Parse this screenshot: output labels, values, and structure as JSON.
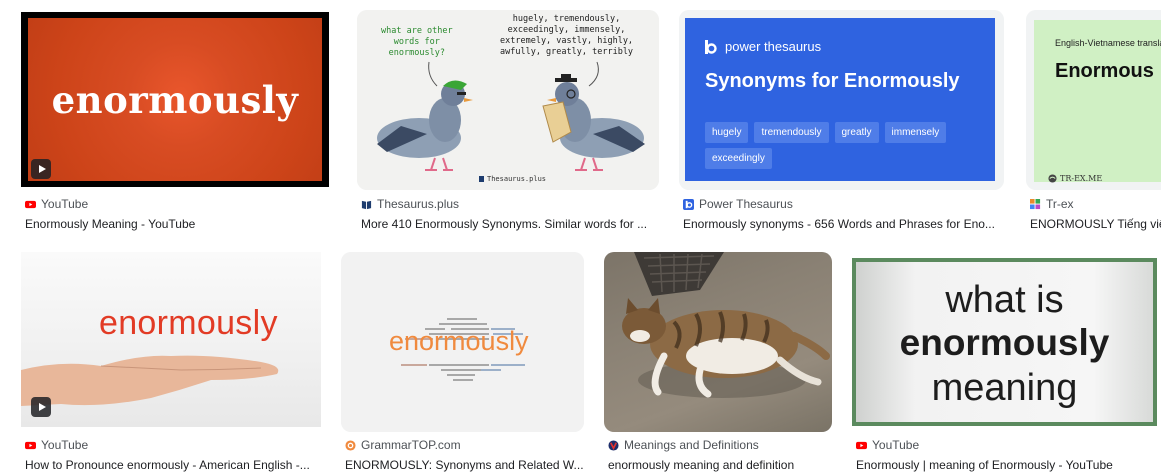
{
  "results": [
    {
      "source": "YouTube",
      "title": "Enormously Meaning - YouTube",
      "image_text": "enormously",
      "favicon": "youtube-icon",
      "has_video": true
    },
    {
      "source": "Thesaurus.plus",
      "title": "More 410 Enormously Synonyms. Similar words for ...",
      "favicon": "book-icon",
      "bubble_left": "what are other\nwords for\nenormously?",
      "bubble_right": "hugely, tremendously,\nexceedingly, immensely,\nextremely, vastly, highly,\nawfully, greatly, terribly",
      "watermark": "Thesaurus.plus"
    },
    {
      "source": "Power Thesaurus",
      "title": "Enormously synonyms - 656 Words and Phrases for Eno...",
      "favicon": "power-thesaurus-icon",
      "brand": "power thesaurus",
      "heading": "Synonyms for Enormously",
      "tags": [
        "hugely",
        "tremendously",
        "greatly",
        "immensely",
        "exceedingly"
      ]
    },
    {
      "source": "Tr-ex",
      "title": "ENORMOUSLY Tiếng việ",
      "favicon": "tr-ex-icon",
      "caption": "English-Vietnamese translat",
      "word": "Enormous",
      "logo": "TR-EX.ME"
    },
    {
      "source": "YouTube",
      "title": "How to Pronounce enormously - American English -...",
      "image_text": "enormously",
      "favicon": "youtube-icon",
      "has_video": true
    },
    {
      "source": "GrammarTOP.com",
      "title": "ENORMOUSLY: Synonyms and Related W...",
      "favicon": "grammartop-icon",
      "image_text": "enormously"
    },
    {
      "source": "Meanings and Definitions",
      "title": "enormously meaning and definition",
      "favicon": "meanings-icon"
    },
    {
      "source": "YouTube",
      "title": "Enormously | meaning of Enormously - YouTube",
      "favicon": "youtube-icon",
      "line1": "what is",
      "line2": "enormously",
      "line3": "meaning"
    }
  ],
  "colors": {
    "youtube_red": "#ff0000",
    "youtube_orange_bg": "#cd4419",
    "power_thesaurus_blue": "#2f63e0",
    "trex_green_bg": "#d0f0c4",
    "grammartop_orange": "#f08a3e"
  }
}
